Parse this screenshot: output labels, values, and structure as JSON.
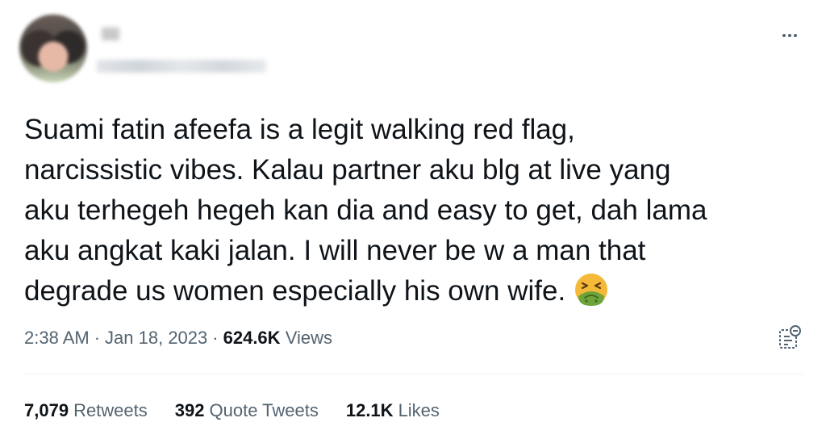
{
  "tweet": {
    "user": {
      "name": "█",
      "handle": "████████"
    },
    "text_lines": [
      "Suami fatin afeefa is a legit walking red flag,",
      "narcissistic vibes. Kalau partner aku blg at live yang",
      "aku terhegeh hegeh kan dia and easy to get, dah lama",
      "aku angkat kaki jalan. I will never be w a man that",
      "degrade us women especially his own wife."
    ],
    "emoji": "nauseated-face",
    "time": "2:38 AM",
    "separator": "·",
    "date": "Jan 18, 2023",
    "views_count": "624.6K",
    "views_label": "Views",
    "stats": {
      "retweets_count": "7,079",
      "retweets_label": "Retweets",
      "quotes_count": "392",
      "quotes_label": "Quote Tweets",
      "likes_count": "12.1K",
      "likes_label": "Likes"
    }
  },
  "icons": {
    "more": "more-icon",
    "analytics": "analytics-icon"
  },
  "colors": {
    "text": "#0f1419",
    "secondary": "#536471",
    "divider": "#eff3f4"
  }
}
